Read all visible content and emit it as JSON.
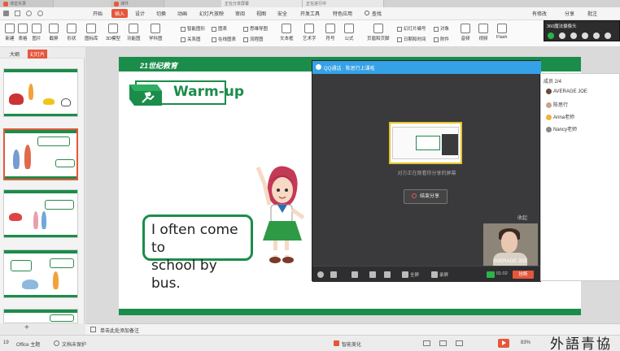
{
  "browser_tabs": [
    "课堂实录",
    "课件",
    "正在分享屏幕",
    "正在进行中"
  ],
  "menu": {
    "items": [
      "开始",
      "插入",
      "设计",
      "切换",
      "动画",
      "幻灯片放映",
      "审阅",
      "视图",
      "安全",
      "开发工具",
      "特色应用",
      "查找"
    ],
    "active_index": 1,
    "right_items": [
      "有修改",
      "分享",
      "批注"
    ]
  },
  "ribbon": {
    "buttons": [
      "新建",
      "表格",
      "图片",
      "截屏",
      "形状",
      "图标库",
      "3D模型",
      "功能图",
      "学科图"
    ],
    "small_col1": [
      "智能图形",
      "关系图"
    ],
    "small_col2": [
      "图表",
      "在线图表"
    ],
    "small_col3": [
      "思维导图",
      "流程图"
    ],
    "buttons2": [
      "文本框",
      "艺术字",
      "符号",
      "公式",
      "页眉和页脚"
    ],
    "small_col4": [
      "幻灯片编号",
      "日期和时间"
    ],
    "small_col5": [
      "对象",
      "附件"
    ],
    "buttons3": [
      "音频",
      "视频",
      "Flash"
    ]
  },
  "mini_window": {
    "title": "360魔法摄像头"
  },
  "left_panel": {
    "tabs": [
      "大纲",
      "幻灯片"
    ]
  },
  "slide": {
    "logo_text": "21世纪教育",
    "heading": "Warm-up",
    "speech_line1": "I often come to",
    "speech_line2": "school by bus."
  },
  "qq": {
    "title": "QQ通话 · 陈思行上课啦",
    "share_message": "对方正在观看你分享的屏幕",
    "stop_share": "结束分享",
    "collapse": "收起",
    "camera_name": "AVERAGE JOE",
    "toolbar": {
      "fullscreen": "全屏",
      "record": "录屏",
      "timer": "01:02",
      "end": "挂断"
    }
  },
  "members": {
    "header": "成员 2/4",
    "list": [
      "AVERAGE JOE",
      "陈思行",
      "Anna老师",
      "Nancy老师"
    ]
  },
  "notes": {
    "placeholder": "单击此处添加备注"
  },
  "status": {
    "slide_num": "19",
    "theme": "Office 主题",
    "protect": "文档未保护",
    "beauty": "智能美化",
    "zoom": "83%",
    "watermark": "外語青協"
  }
}
